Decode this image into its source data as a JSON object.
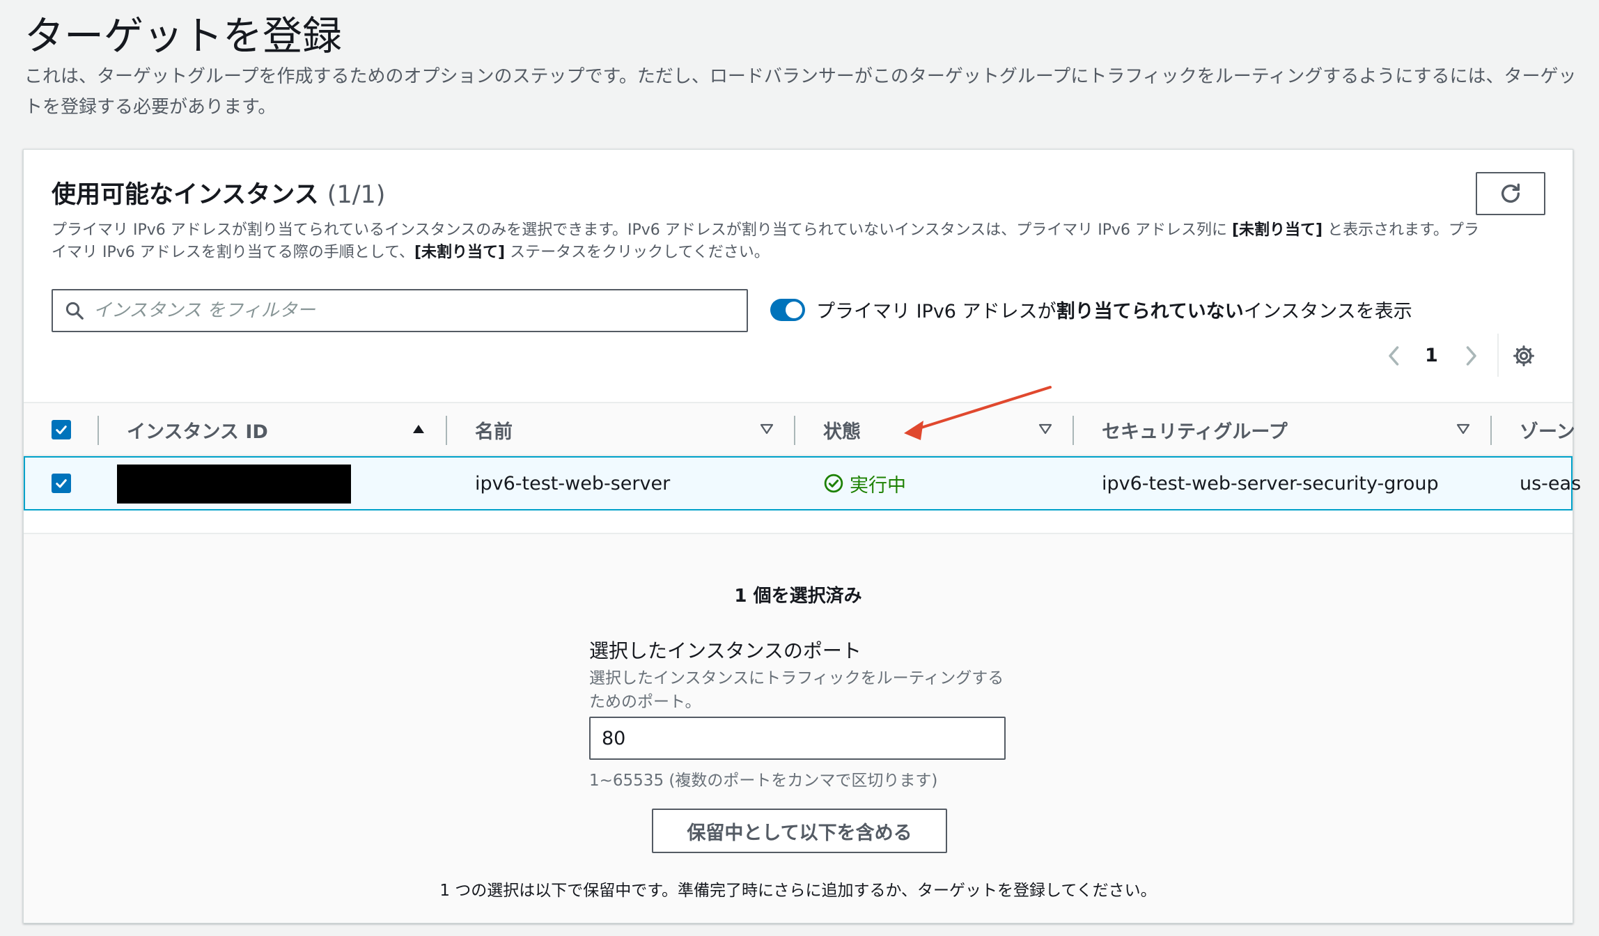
{
  "page": {
    "title": "ターゲットを登録",
    "description": "これは、ターゲットグループを作成するためのオプションのステップです。ただし、ロードバランサーがこのターゲットグループにトラフィックをルーティングするようにするには、ターゲットを登録する必要があります。"
  },
  "instances_panel": {
    "title": "使用可能なインスタンス",
    "count": "(1/1)",
    "desc_part1": "プライマリ IPv6 アドレスが割り当てられているインスタンスのみを選択できます。IPv6 アドレスが割り当てられていないインスタンスは、プライマリ IPv6 アドレス列に ",
    "desc_bold1": "[未割り当て]",
    "desc_part2": " と表示されます。プライマリ IPv6 アドレスを割り当てる際の手順として、",
    "desc_bold2": "[未割り当て]",
    "desc_part3": " ステータスをクリックしてください。",
    "search_placeholder": "インスタンス をフィルター",
    "toggle_label_pre": "プライマリ IPv6 アドレスが",
    "toggle_label_bold": "割り当てられていない",
    "toggle_label_post": "インスタンスを表示",
    "toggle_on": true,
    "current_page": "1"
  },
  "table": {
    "columns": [
      "インスタンス ID",
      "名前",
      "状態",
      "セキュリティグループ",
      "ゾーン"
    ],
    "rows": [
      {
        "instance_id": "",
        "name": "ipv6-test-web-server",
        "state": "実行中",
        "security_group": "ipv6-test-web-server-security-group",
        "zone": "us-eas"
      }
    ]
  },
  "selection": {
    "selected_count": "1 個を選択済み",
    "port_label": "選択したインスタンスのポート",
    "port_desc": "選択したインスタンスにトラフィックをルーティングするためのポート。",
    "port_value": "80",
    "port_hint": "1~65535 (複数のポートをカンマで区切ります)",
    "include_button": "保留中として以下を含める",
    "footer_note": "1 つの選択は以下で保留中です。準備完了時にさらに追加するか、ターゲットを登録してください。"
  },
  "colors": {
    "primary": "#0073bb",
    "success": "#1d8102",
    "annotation_arrow": "#e0482e"
  }
}
